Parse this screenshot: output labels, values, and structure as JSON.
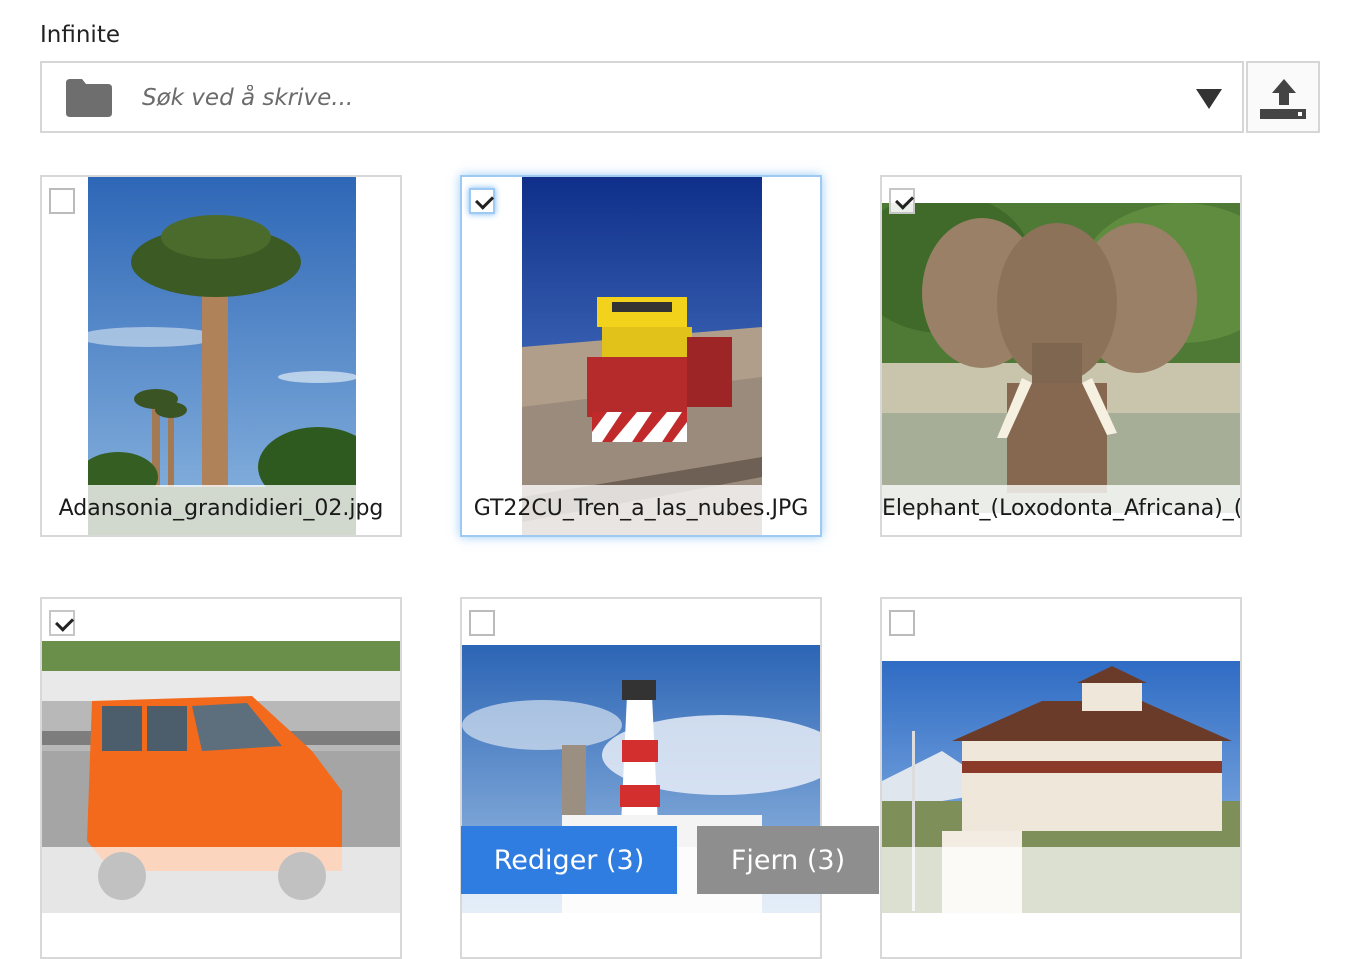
{
  "field": {
    "label": "Infinite",
    "search_placeholder": "Søk ved å skrive..."
  },
  "icons": {
    "folder": "folder-icon",
    "dropdown": "triangle-down-icon",
    "upload": "upload-icon"
  },
  "images": [
    {
      "caption": "Adansonia_grandidieri_02.jpg",
      "checked": false,
      "selected": false
    },
    {
      "caption": "GT22CU_Tren_a_las_nubes.JPG",
      "checked": true,
      "selected": true
    },
    {
      "caption": "Elephant_(Loxodonta_Africana)_(",
      "checked": true,
      "selected": false
    },
    {
      "caption": "",
      "checked": true,
      "selected": false
    },
    {
      "caption": "",
      "checked": false,
      "selected": false
    },
    {
      "caption": "",
      "checked": false,
      "selected": false
    }
  ],
  "actions": {
    "edit_label": "Rediger (3)",
    "remove_label": "Fjern (3)"
  },
  "colors": {
    "primary": "#2f7de1",
    "secondary": "#8e8e8e",
    "selected_border": "#9ccaf3"
  }
}
